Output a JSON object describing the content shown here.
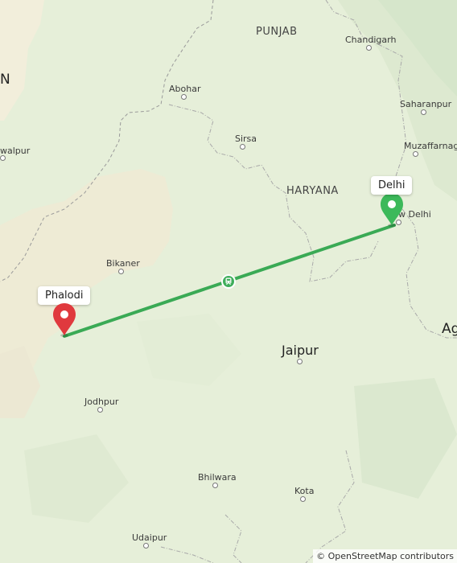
{
  "map": {
    "labels": {
      "punjab": "PUNJAB",
      "haryana": "HARYANA",
      "chandigarh": "Chandigarh",
      "abohar": "Abohar",
      "sirsa": "Sirsa",
      "saharanpur": "Saharanpur",
      "muzaffarnagar": "Muzaffarnaga",
      "bahawalpur": "walpur",
      "bikaner": "Bikaner",
      "new_delhi": "New Delhi",
      "jaipur": "Jaipur",
      "jodhpur": "Jodhpur",
      "bhilwara": "Bhilwara",
      "kota": "Kota",
      "udaipur": "Udaipur",
      "agra_partial": "Ag",
      "pakistan_partial": "N"
    },
    "route": {
      "origin": "Phalodi",
      "destination": "Delhi",
      "mode": "train",
      "origin_color": "#e0393e",
      "destination_color": "#3cb95a",
      "line_color": "#3aaa55"
    },
    "attribution": "© OpenStreetMap contributors"
  }
}
